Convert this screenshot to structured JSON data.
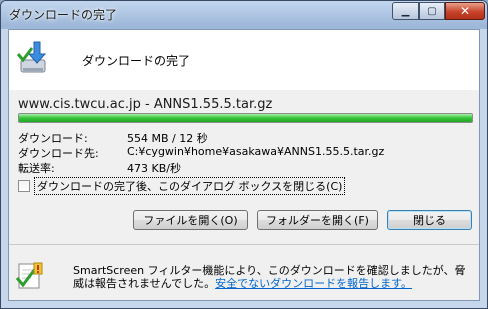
{
  "window": {
    "title": "ダウンロードの完了",
    "controls": {
      "minimize": "▁",
      "maximize": "▢",
      "close": "✕"
    }
  },
  "header": {
    "title": "ダウンロードの完了",
    "icon": "download-complete-icon"
  },
  "download": {
    "url": "www.cis.twcu.ac.jp - ANNS1.55.5.tar.gz",
    "progress_fraction": 1.0,
    "progress_color": "#37c43a",
    "details": [
      {
        "label": "ダウンロード:",
        "value": "554 MB / 12 秒"
      },
      {
        "label": "ダウンロード先:",
        "value": "C:¥cygwin¥home¥asakawa¥ANNS1.55.5.tar.gz"
      },
      {
        "label": "転送率:",
        "value": "473 KB/秒"
      }
    ]
  },
  "close_on_complete": {
    "checked": false,
    "label": "ダウンロードの完了後、このダイアログ ボックスを閉じる(C)"
  },
  "buttons": {
    "open_file": "ファイルを開く(O)",
    "open_folder": "フォルダーを開く(F)",
    "close": "閉じる"
  },
  "footer": {
    "icon": "smartscreen-shield-icon",
    "text": "SmartScreen フィルター機能により、このダウンロードを確認しましたが、脅威は報告されませんでした。",
    "link": "安全でないダウンロードを報告します。"
  }
}
